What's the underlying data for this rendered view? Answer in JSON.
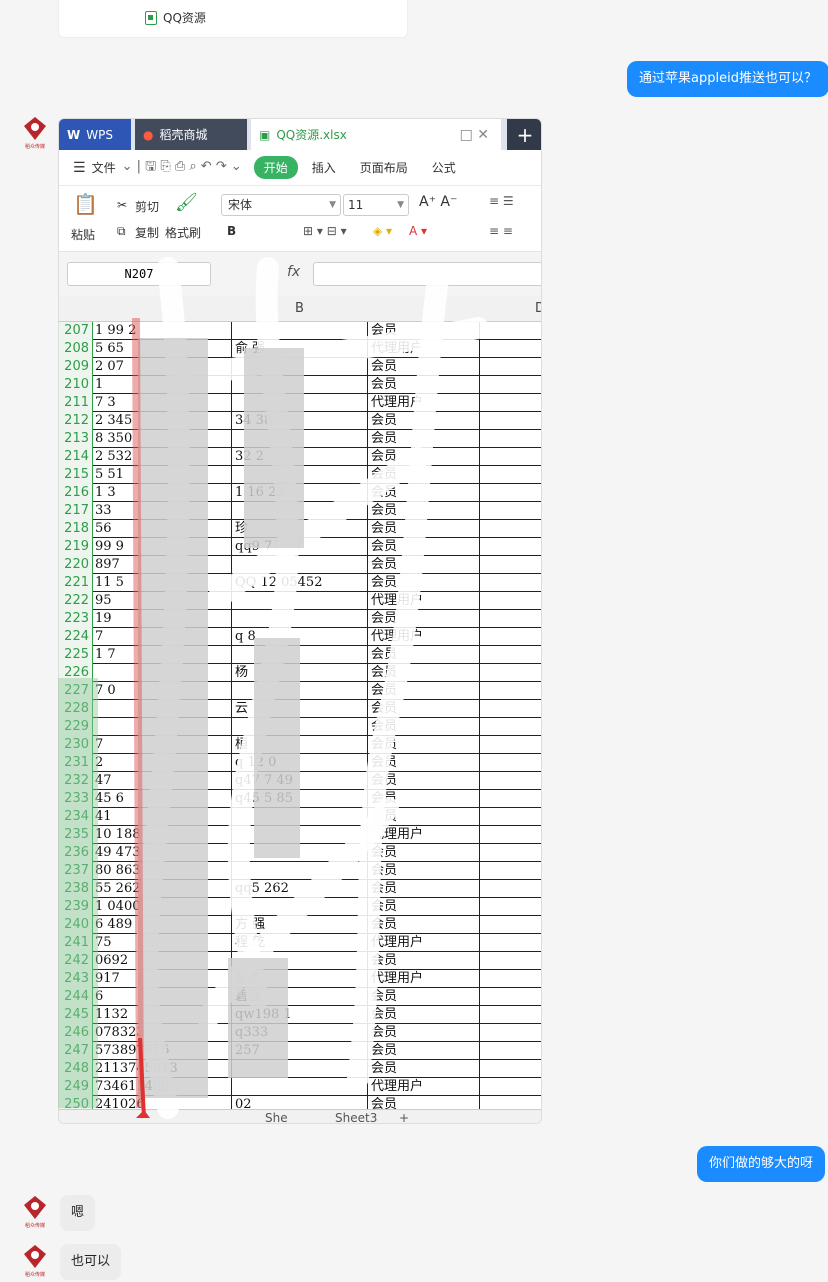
{
  "prev_card": {
    "file_name": "QQ资源"
  },
  "messages": {
    "m1": "通过苹果appleid推送也可以？",
    "m2": "你们做的够大的呀",
    "m3": "嗯",
    "m4": "也可以"
  },
  "avatar_label": "稻众传媒",
  "excel": {
    "tabs": {
      "wps": "WPS",
      "store": "稻壳商城",
      "file": "QQ资源.xlsx"
    },
    "menu": {
      "file": "文件",
      "start": "开始",
      "insert": "插入",
      "layout": "页面布局",
      "formula": "公式"
    },
    "ribbon": {
      "paste": "粘贴",
      "cut": "剪切",
      "copy": "复制",
      "format_painter": "格式刷",
      "font": "宋体",
      "size": "11"
    },
    "namebox": "N207",
    "fx": "fx",
    "columns": {
      "b": "B",
      "d": "D"
    },
    "rows": [
      {
        "n": "207",
        "a": "1 99   2",
        "b": "",
        "c": "会员"
      },
      {
        "n": "208",
        "a": "5 65",
        "b": "俞  强",
        "c": "代理用户"
      },
      {
        "n": "209",
        "a": "2 07",
        "b": "",
        "c": "会员"
      },
      {
        "n": "210",
        "a": "1",
        "b": "",
        "c": "会员"
      },
      {
        "n": "211",
        "a": "7   3",
        "b": "",
        "c": "代理用户"
      },
      {
        "n": "212",
        "a": "2  345",
        "b": "     34  38",
        "c": "会员"
      },
      {
        "n": "213",
        "a": "8  350",
        "b": "",
        "c": "会员"
      },
      {
        "n": "214",
        "a": "2  532",
        "b": "      32  2",
        "c": "会员"
      },
      {
        "n": "215",
        "a": "5  51",
        "b": "",
        "c": "会员"
      },
      {
        "n": "216",
        "a": "1  3",
        "b": "   1   16  22",
        "c": "会员"
      },
      {
        "n": "217",
        "a": "33",
        "b": "",
        "c": "会员"
      },
      {
        "n": "218",
        "a": "56",
        "b": "  珍",
        "c": "会员"
      },
      {
        "n": "219",
        "a": "99    9",
        "b": "qq9   744  9",
        "c": "会员"
      },
      {
        "n": "220",
        "a": "897",
        "b": "",
        "c": "会员"
      },
      {
        "n": "221",
        "a": "11     5",
        "b": "QQ    12  05452",
        "c": "会员"
      },
      {
        "n": "222",
        "a": "95",
        "b": "",
        "c": "代理用户"
      },
      {
        "n": "223",
        "a": "19",
        "b": "",
        "c": "会员"
      },
      {
        "n": "224",
        "a": "7",
        "b": "q     8",
        "c": "代理用户"
      },
      {
        "n": "225",
        "a": "1       7",
        "b": "",
        "c": "会员"
      },
      {
        "n": "226",
        "a": "",
        "b": "杨",
        "c": "会员"
      },
      {
        "n": "227",
        "a": "  7     0",
        "b": "",
        "c": "会员"
      },
      {
        "n": "228",
        "a": "",
        "b": "  云",
        "c": "会员"
      },
      {
        "n": "229",
        "a": "",
        "b": "",
        "c": "会员"
      },
      {
        "n": "230",
        "a": "  7",
        "b": "  桓",
        "c": "会员"
      },
      {
        "n": "231",
        "a": "  2",
        "b": "q 12    0",
        "c": "会员"
      },
      {
        "n": "232",
        "a": "47",
        "b": "q47   7  49",
        "c": "会员"
      },
      {
        "n": "233",
        "a": "45     6",
        "b": "q45    5  85",
        "c": "会员"
      },
      {
        "n": "234",
        "a": "41",
        "b": "",
        "c": "会员"
      },
      {
        "n": "235",
        "a": "10     188",
        "b": "",
        "c": "代理用户"
      },
      {
        "n": "236",
        "a": "49    473",
        "b": "",
        "c": "会员"
      },
      {
        "n": "237",
        "a": "80    863",
        "b": "",
        "c": "会员"
      },
      {
        "n": "238",
        "a": "55    262",
        "b": "qq5    262",
        "c": "会员"
      },
      {
        "n": "239",
        "a": "1    0400",
        "b": "",
        "c": "会员"
      },
      {
        "n": "240",
        "a": "6    489",
        "b": "方  强",
        "c": "会员"
      },
      {
        "n": "241",
        "a": "     75",
        "b": "程  乾",
        "c": "代理用户"
      },
      {
        "n": "242",
        "a": "    0692",
        "b": "",
        "c": "会员"
      },
      {
        "n": "243",
        "a": "    917",
        "b": "  智杰",
        "c": "代理用户"
      },
      {
        "n": "244",
        "a": "    6",
        "b": "  碧强",
        "c": "会员"
      },
      {
        "n": "245",
        "a": "    1132",
        "b": "qw198   1",
        "c": "会员"
      },
      {
        "n": "246",
        "a": "    078323",
        "b": "q333",
        "c": "会员"
      },
      {
        "n": "247",
        "a": "573897816",
        "b": "  257",
        "c": "会员"
      },
      {
        "n": "248",
        "a": "2113745013",
        "b": "",
        "c": "会员"
      },
      {
        "n": "249",
        "a": "734611406",
        "b": "",
        "c": "代理用户"
      },
      {
        "n": "250",
        "a": "241026",
        "b": "  02",
        "c": "会员"
      }
    ],
    "sheets": {
      "s2": "She",
      "s3": "Sheet3",
      "add": "+"
    }
  }
}
